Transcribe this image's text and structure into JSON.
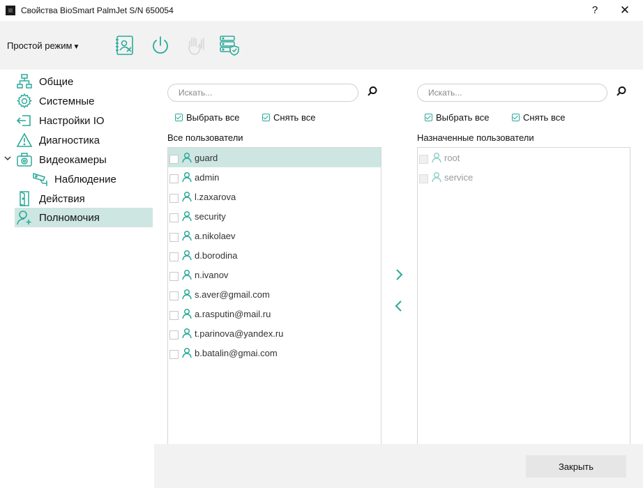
{
  "window": {
    "title": "Свойства BioSmart PalmJet S/N 650054",
    "help_label": "?",
    "close_label": "✕"
  },
  "toolbar": {
    "mode_label": "Простой режим",
    "mode_caret": "▼",
    "icons": [
      "user-card-icon",
      "power-icon",
      "palm-icon",
      "server-shield-icon"
    ],
    "accent": "#2aaa9a"
  },
  "sidebar": {
    "items": [
      {
        "label": "Общие",
        "icon": "network-icon"
      },
      {
        "label": "Системные",
        "icon": "gear-icon"
      },
      {
        "label": "Настройки IO",
        "icon": "io-arrow-icon"
      },
      {
        "label": "Диагностика",
        "icon": "warning-icon"
      },
      {
        "label": "Видеокамеры",
        "icon": "camera-icon"
      },
      {
        "label": "Наблюдение",
        "icon": "cctv-icon"
      },
      {
        "label": "Действия",
        "icon": "door-icon"
      },
      {
        "label": "Полномочия",
        "icon": "user-add-icon"
      }
    ],
    "active_index": 7,
    "active_bg": "#cde6e2"
  },
  "left_panel": {
    "search_placeholder": "Искать...",
    "select_all": "Выбрать все",
    "deselect_all": "Снять все",
    "title": "Все пользователи",
    "users": [
      "guard",
      "admin",
      "l.zaxarova",
      "security",
      "a.nikolaev",
      "d.borodina",
      "n.ivanov",
      "s.aver@gmail.com",
      "a.rasputin@mail.ru",
      "t.parinova@yandex.ru",
      "b.batalin@gmai.com"
    ],
    "selected_index": 0
  },
  "right_panel": {
    "search_placeholder": "Искать...",
    "select_all": "Выбрать все",
    "deselect_all": "Снять все",
    "title": "Назначенные пользователи",
    "users": [
      "root",
      "service"
    ]
  },
  "footer": {
    "close_button": "Закрыть"
  }
}
